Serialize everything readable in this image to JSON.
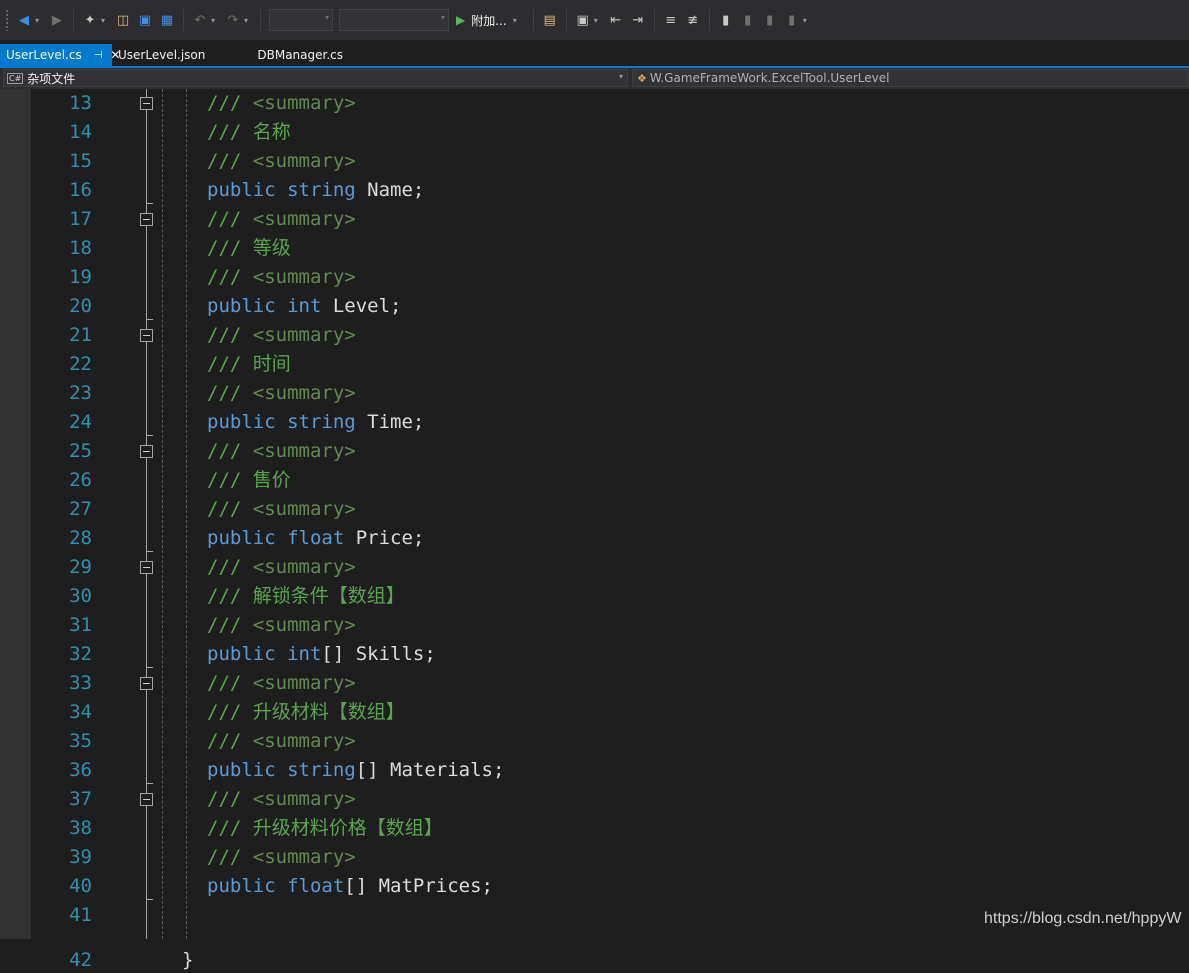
{
  "toolbar": {
    "attach_label": "附加...",
    "icons": [
      "back-icon",
      "forward-icon",
      "new-project-icon",
      "open-folder-icon",
      "save-icon",
      "save-all-icon",
      "undo-icon",
      "redo-icon",
      "start-icon",
      "find-files-icon",
      "screenshot-icon",
      "comment-icon",
      "uncomment-icon",
      "bookmark-icon"
    ]
  },
  "tabs": [
    {
      "label": "UserLevel.cs",
      "active": true
    },
    {
      "label": "UserLevel.json",
      "active": false
    },
    {
      "label": "DBManager.cs",
      "active": false
    }
  ],
  "navbar": {
    "project": "杂项文件",
    "cs_badge": "C#",
    "class_path": "W.GameFrameWork.ExcelTool.UserLevel"
  },
  "editor": {
    "lines": [
      {
        "n": "13",
        "tokens": [
          {
            "t": "/// ",
            "c": "comment"
          },
          {
            "t": "<summary>",
            "c": "tag"
          }
        ],
        "fold": true
      },
      {
        "n": "14",
        "tokens": [
          {
            "t": "/// 名称",
            "c": "comment"
          }
        ]
      },
      {
        "n": "15",
        "tokens": [
          {
            "t": "/// ",
            "c": "comment"
          },
          {
            "t": "<summary>",
            "c": "tag"
          }
        ]
      },
      {
        "n": "16",
        "tokens": [
          {
            "t": "public ",
            "c": "kw"
          },
          {
            "t": "string ",
            "c": "kw"
          },
          {
            "t": "Name;",
            "c": "id"
          }
        ]
      },
      {
        "n": "17",
        "tokens": [
          {
            "t": "/// ",
            "c": "comment"
          },
          {
            "t": "<summary>",
            "c": "tag"
          }
        ],
        "fold": true
      },
      {
        "n": "18",
        "tokens": [
          {
            "t": "/// 等级",
            "c": "comment"
          }
        ]
      },
      {
        "n": "19",
        "tokens": [
          {
            "t": "/// ",
            "c": "comment"
          },
          {
            "t": "<summary>",
            "c": "tag"
          }
        ]
      },
      {
        "n": "20",
        "tokens": [
          {
            "t": "public ",
            "c": "kw"
          },
          {
            "t": "int ",
            "c": "kw"
          },
          {
            "t": "Level;",
            "c": "id"
          }
        ]
      },
      {
        "n": "21",
        "tokens": [
          {
            "t": "/// ",
            "c": "comment"
          },
          {
            "t": "<summary>",
            "c": "tag"
          }
        ],
        "fold": true
      },
      {
        "n": "22",
        "tokens": [
          {
            "t": "/// 时间",
            "c": "comment"
          }
        ]
      },
      {
        "n": "23",
        "tokens": [
          {
            "t": "/// ",
            "c": "comment"
          },
          {
            "t": "<summary>",
            "c": "tag"
          }
        ]
      },
      {
        "n": "24",
        "tokens": [
          {
            "t": "public ",
            "c": "kw"
          },
          {
            "t": "string ",
            "c": "kw"
          },
          {
            "t": "Time;",
            "c": "id"
          }
        ]
      },
      {
        "n": "25",
        "tokens": [
          {
            "t": "/// ",
            "c": "comment"
          },
          {
            "t": "<summary>",
            "c": "tag"
          }
        ],
        "fold": true
      },
      {
        "n": "26",
        "tokens": [
          {
            "t": "/// 售价",
            "c": "comment"
          }
        ]
      },
      {
        "n": "27",
        "tokens": [
          {
            "t": "/// ",
            "c": "comment"
          },
          {
            "t": "<summary>",
            "c": "tag"
          }
        ]
      },
      {
        "n": "28",
        "tokens": [
          {
            "t": "public ",
            "c": "kw"
          },
          {
            "t": "float ",
            "c": "kw"
          },
          {
            "t": "Price;",
            "c": "id"
          }
        ]
      },
      {
        "n": "29",
        "tokens": [
          {
            "t": "/// ",
            "c": "comment"
          },
          {
            "t": "<summary>",
            "c": "tag"
          }
        ],
        "fold": true
      },
      {
        "n": "30",
        "tokens": [
          {
            "t": "/// 解锁条件【数组】",
            "c": "comment"
          }
        ]
      },
      {
        "n": "31",
        "tokens": [
          {
            "t": "/// ",
            "c": "comment"
          },
          {
            "t": "<summary>",
            "c": "tag"
          }
        ]
      },
      {
        "n": "32",
        "tokens": [
          {
            "t": "public ",
            "c": "kw"
          },
          {
            "t": "int",
            "c": "kw"
          },
          {
            "t": "[] Skills;",
            "c": "id"
          }
        ]
      },
      {
        "n": "33",
        "tokens": [
          {
            "t": "/// ",
            "c": "comment"
          },
          {
            "t": "<summary>",
            "c": "tag"
          }
        ],
        "fold": true
      },
      {
        "n": "34",
        "tokens": [
          {
            "t": "/// 升级材料【数组】",
            "c": "comment"
          }
        ]
      },
      {
        "n": "35",
        "tokens": [
          {
            "t": "/// ",
            "c": "comment"
          },
          {
            "t": "<summary>",
            "c": "tag"
          }
        ]
      },
      {
        "n": "36",
        "tokens": [
          {
            "t": "public ",
            "c": "kw"
          },
          {
            "t": "string",
            "c": "kw"
          },
          {
            "t": "[] Materials;",
            "c": "id"
          }
        ]
      },
      {
        "n": "37",
        "tokens": [
          {
            "t": "/// ",
            "c": "comment"
          },
          {
            "t": "<summary>",
            "c": "tag"
          }
        ],
        "fold": true
      },
      {
        "n": "38",
        "tokens": [
          {
            "t": "/// 升级材料价格【数组】",
            "c": "comment"
          }
        ]
      },
      {
        "n": "39",
        "tokens": [
          {
            "t": "/// ",
            "c": "comment"
          },
          {
            "t": "<summary>",
            "c": "tag"
          }
        ]
      },
      {
        "n": "40",
        "tokens": [
          {
            "t": "public ",
            "c": "kw"
          },
          {
            "t": "float",
            "c": "kw"
          },
          {
            "t": "[] MatPrices;",
            "c": "id"
          }
        ]
      },
      {
        "n": "41",
        "tokens": []
      },
      {
        "n": "42",
        "tokens": [
          {
            "t": "}",
            "c": "punc"
          }
        ],
        "partial": true
      }
    ]
  },
  "watermark": "https://blog.csdn.net/hppyW"
}
